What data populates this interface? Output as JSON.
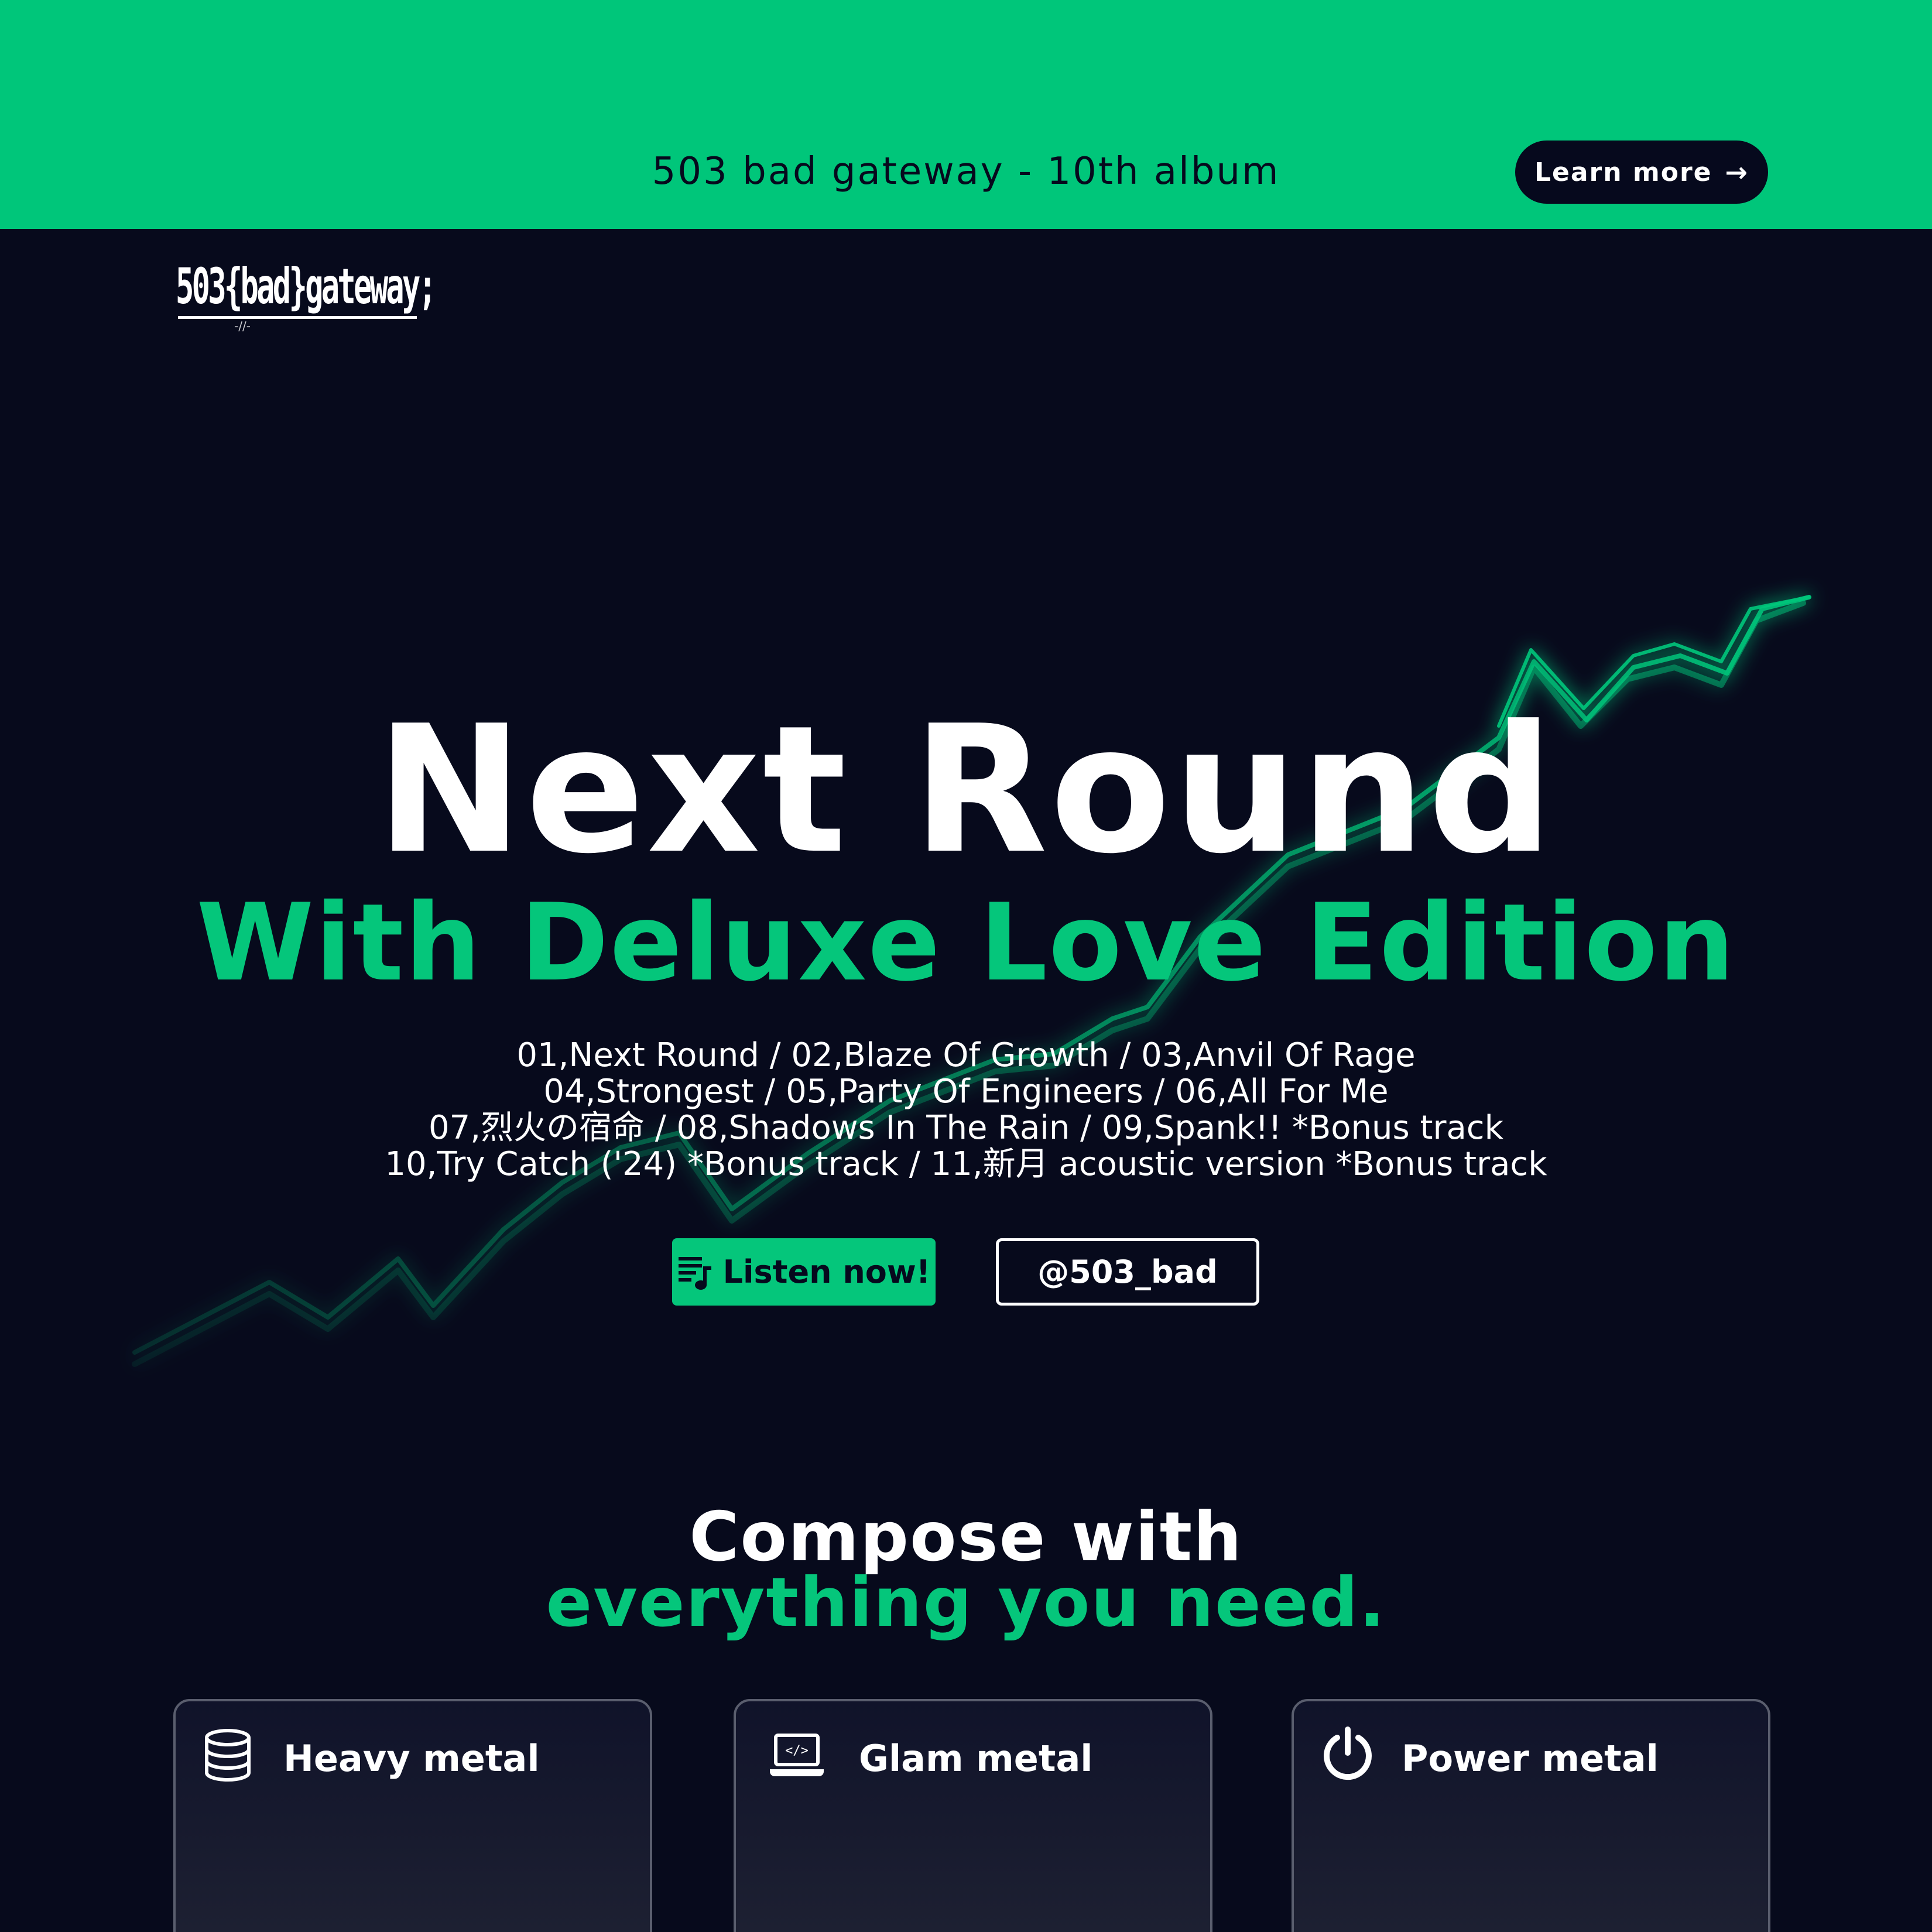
{
  "banner": {
    "title": "503 bad gateway - 10th album",
    "cta_label": "Learn more",
    "cta_icon": "arrow-right-icon"
  },
  "brand": {
    "logo_text": "503{bad}gateway;"
  },
  "hero": {
    "title": "Next Round",
    "subtitle": "With Deluxe Love Edition",
    "tracklist": [
      "01,Next Round / 02,Blaze Of Growth / 03,Anvil Of Rage",
      "04,Strongest / 05,Party Of Engineers / 06,All For Me",
      "07,烈火の宿命 / 08,Shadows In The Rain / 09,Spank!! *Bonus track",
      "10,Try Catch ('24) *Bonus track / 11,新月 acoustic version *Bonus track"
    ],
    "listen_label": "Listen now!",
    "listen_icon": "playlist-music-icon",
    "handle_label": "@503_bad"
  },
  "features": {
    "heading": "Compose with",
    "heading_accent": "everything you need.",
    "cards": [
      {
        "label": "Heavy metal",
        "icon": "database-icon"
      },
      {
        "label": "Glam metal",
        "icon": "laptop-code-icon"
      },
      {
        "label": "Power metal",
        "icon": "power-icon"
      }
    ]
  },
  "colors": {
    "accent": "#05c67b",
    "background": "#070a1c",
    "banner": "#00c67a"
  }
}
